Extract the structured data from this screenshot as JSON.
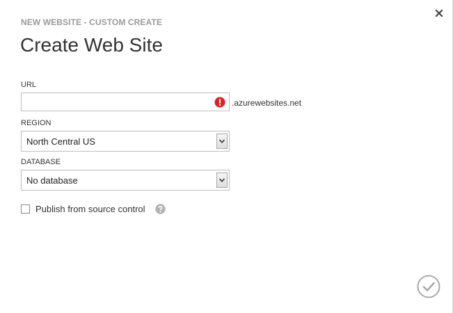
{
  "dialog": {
    "subtitle": "NEW WEBSITE - CUSTOM CREATE",
    "title": "Create Web Site"
  },
  "url": {
    "label": "URL",
    "value": "",
    "placeholder": "",
    "suffix": ".azurewebsites.net",
    "status": "error"
  },
  "region": {
    "label": "REGION",
    "selected": "North Central US"
  },
  "database": {
    "label": "DATABASE",
    "selected": "No database"
  },
  "publish": {
    "label": "Publish from source control",
    "checked": false
  },
  "icons": {
    "close": "close-icon",
    "error": "error-icon",
    "dropdown": "chevron-down-icon",
    "help": "help-icon",
    "confirm": "checkmark-icon"
  },
  "colors": {
    "error": "#e01f1f",
    "muted": "#9a9a9a",
    "icon_gray": "#a9a9a9"
  }
}
